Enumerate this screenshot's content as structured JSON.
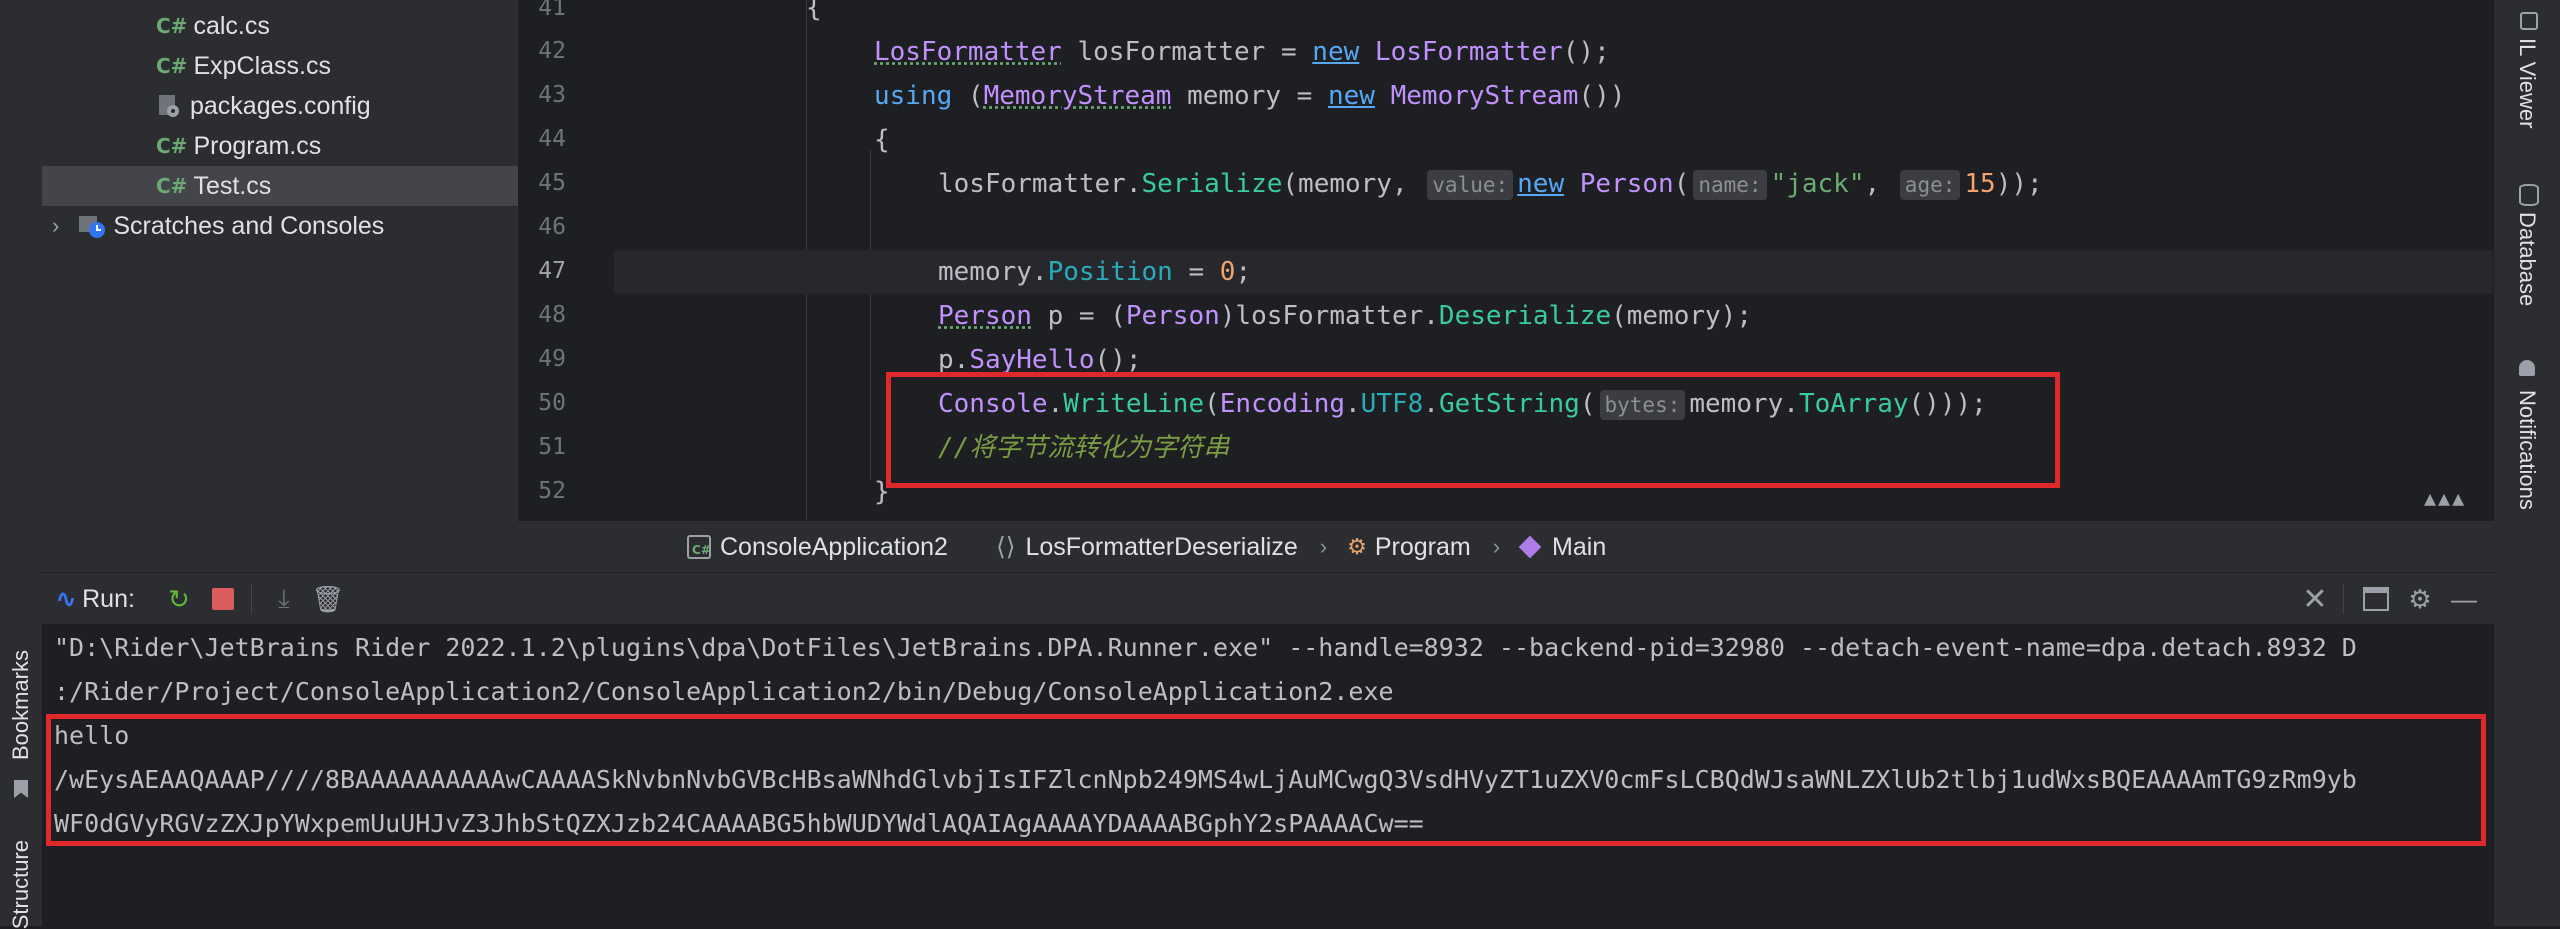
{
  "project_tree": {
    "items": [
      {
        "icon": "C#",
        "label": "calc.cs"
      },
      {
        "icon": "C#",
        "label": "ExpClass.cs"
      },
      {
        "icon": "config",
        "label": "packages.config"
      },
      {
        "icon": "C#",
        "label": "Program.cs"
      },
      {
        "icon": "C#",
        "label": "Test.cs"
      }
    ],
    "scratches_label": "Scratches and Consoles"
  },
  "editor": {
    "line_numbers": [
      "41",
      "42",
      "43",
      "44",
      "45",
      "46",
      "47",
      "48",
      "49",
      "50",
      "51",
      "52"
    ],
    "lines": {
      "l41": "{",
      "l42_type": "LosFormatter",
      "l42_var": " losFormatter = ",
      "l42_new": "new",
      "l42_ctor": "LosFormatter",
      "l42_end": "();",
      "l43_using": "using",
      "l43_open": " (",
      "l43_type": "MemoryStream",
      "l43_var": " memory = ",
      "l43_new": "new",
      "l43_ctor": "MemoryStream",
      "l43_end": "())",
      "l44": "{",
      "l45_obj": "losFormatter.",
      "l45_method": "Serialize",
      "l45_args": "(memory, ",
      "l45_hint_value": "value:",
      "l45_new": "new",
      "l45_type": "Person",
      "l45_paren": "(",
      "l45_hint_name": "name:",
      "l45_str": "\"jack\"",
      "l45_comma": ", ",
      "l45_hint_age": "age:",
      "l45_num": "15",
      "l45_end": "));",
      "l47_obj": "memory.",
      "l47_prop": "Position",
      "l47_eq": " = ",
      "l47_num": "0",
      "l47_end": ";",
      "l48_type": "Person",
      "l48_var": " p = (",
      "l48_cast": "Person",
      "l48_obj": ")losFormatter.",
      "l48_method": "Deserialize",
      "l48_end": "(memory);",
      "l49_obj": "p.",
      "l49_method": "SayHello",
      "l49_end": "();",
      "l50_cls": "Console",
      "l50_dot": ".",
      "l50_method": "WriteLine",
      "l50_paren": "(",
      "l50_enc": "Encoding",
      "l50_dot2": ".",
      "l50_utf": "UTF8",
      "l50_dot3": ".",
      "l50_get": "GetString",
      "l50_paren2": "(",
      "l50_hint": "bytes:",
      "l50_mem": "memory.",
      "l50_toarr": "ToArray",
      "l50_end": "()));",
      "l51_comment": "//将字节流转化为字符串",
      "l52": "}"
    }
  },
  "breadcrumbs": [
    "ConsoleApplication2",
    "LosFormatterDeserialize",
    "Program",
    "Main"
  ],
  "run_panel": {
    "title": "Run:",
    "output": [
      "\"D:\\Rider\\JetBrains Rider 2022.1.2\\plugins\\dpa\\DotFiles\\JetBrains.DPA.Runner.exe\" --handle=8932 --backend-pid=32980 --detach-event-name=dpa.detach.8932 D",
      ":/Rider/Project/ConsoleApplication2/ConsoleApplication2/bin/Debug/ConsoleApplication2.exe",
      "hello",
      "/wEysAEAAQAAAP////8BAAAAAAAAAAwCAAAASkNvbnNvbGVBcHBsaWNhdGlvbjIsIFZlcnNpb249MS4wLjAuMCwgQ3VsdHVyZT1uZXV0cmFsLCBQdWJsaWNLZXlUb2tlbj1udWxsBQEAAAAmTG9zRm9yb",
      "WF0dGVyRGVzZXJpYWxpemUuUHJvZ3JhbStQZXJzb24CAAAABG5hbWUDYWdlAQAIAgAAAAYDAAAABGphY2sPAAAACw=="
    ]
  },
  "right_tools": [
    "IL Viewer",
    "Database",
    "Notifications"
  ],
  "left_tools": [
    "Bookmarks",
    "Structure"
  ],
  "colors": {
    "highlight_box": "#e0292d",
    "editor_bg": "#1e1f22",
    "panel_bg": "#2b2d30"
  }
}
